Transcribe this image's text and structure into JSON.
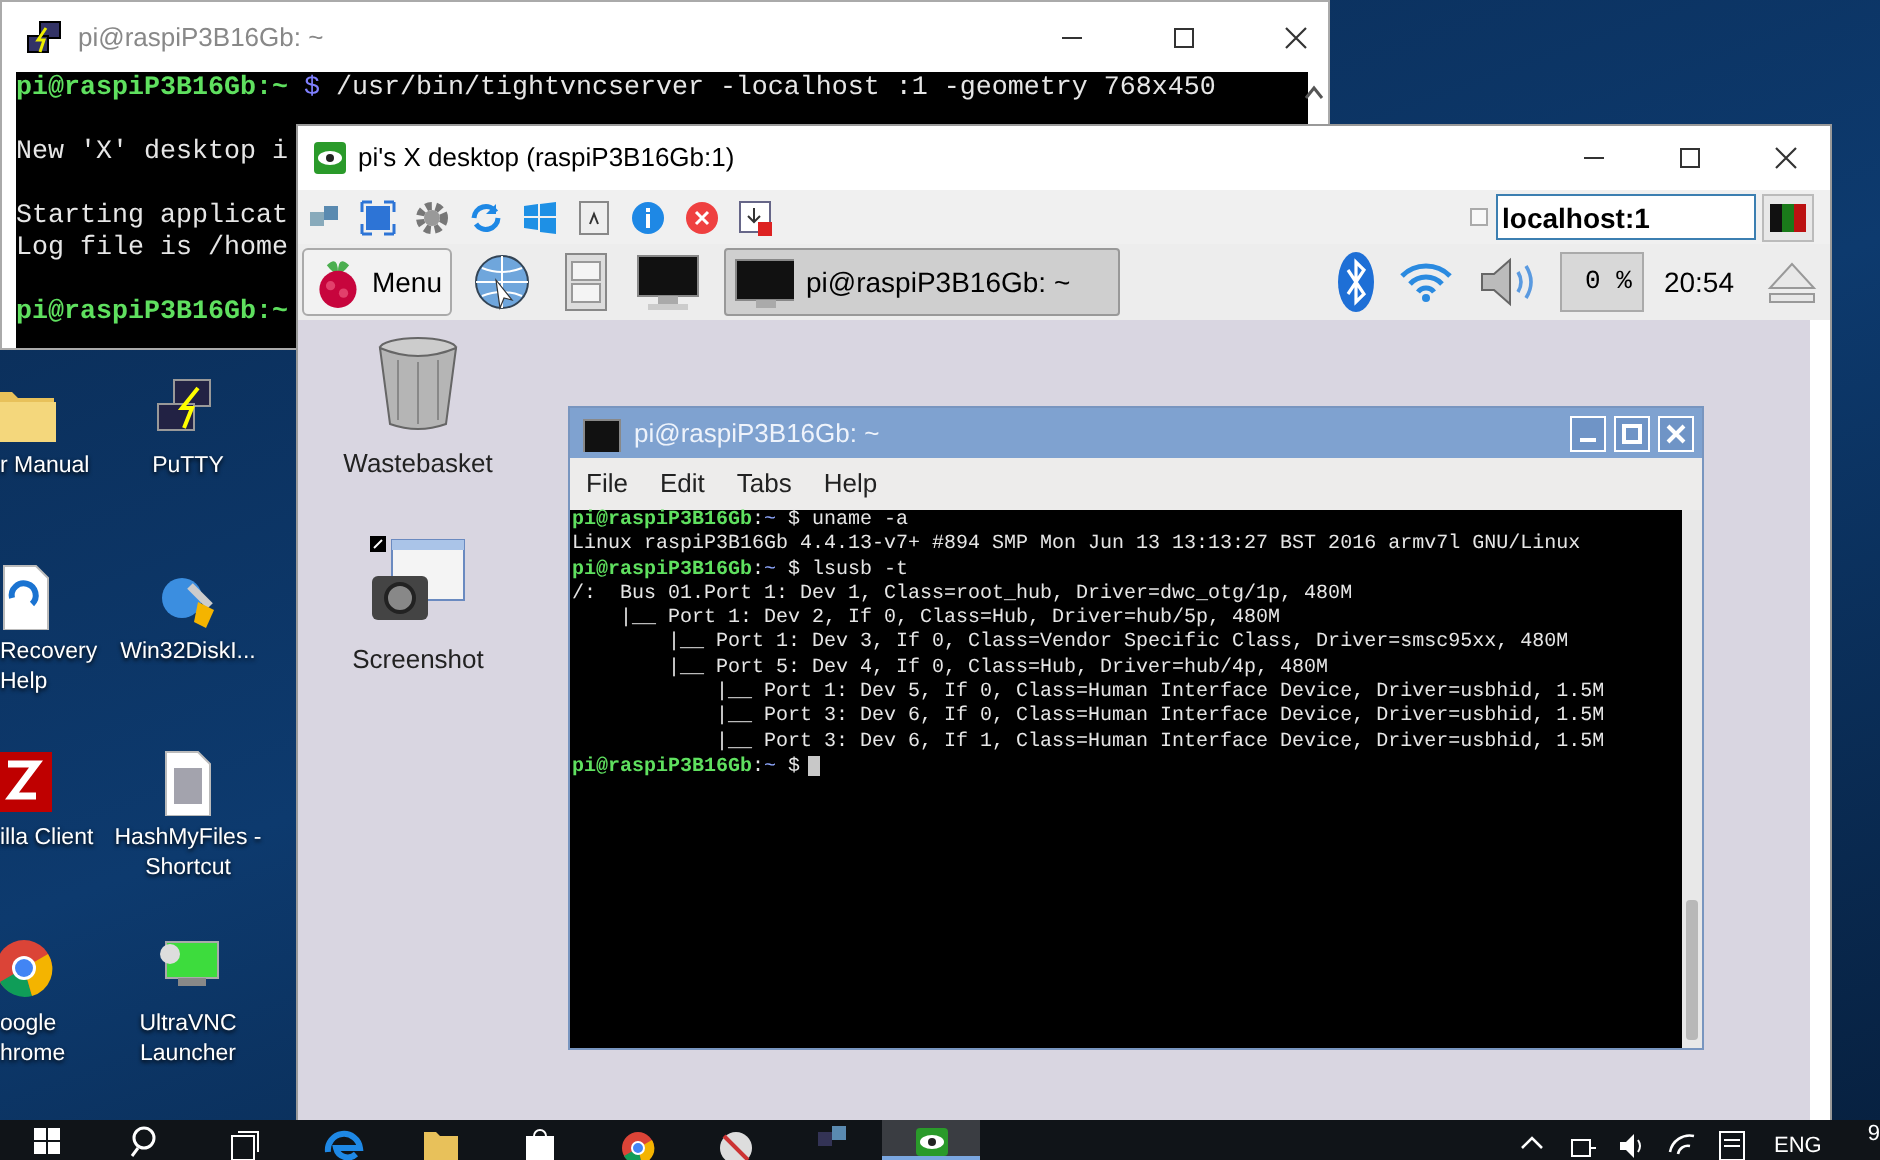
{
  "putty": {
    "title": "pi@raspiP3B16Gb: ~",
    "lines": [
      {
        "kind": "text",
        "segments": [
          {
            "text": "pi@raspiP3B16Gb:~",
            "kind": "host"
          },
          {
            "text": " $",
            "kind": "sign"
          },
          {
            "text": " /usr/bin/tightvncserver -localhost :1 -geometry 768x450",
            "kind": "plain"
          }
        ]
      },
      {
        "kind": "blank"
      },
      {
        "kind": "text",
        "segments": [
          {
            "text": "New 'X' desktop i",
            "kind": "plain"
          }
        ]
      },
      {
        "kind": "blank"
      },
      {
        "kind": "text",
        "segments": [
          {
            "text": "Starting applicat",
            "kind": "plain"
          }
        ]
      },
      {
        "kind": "text",
        "segments": [
          {
            "text": "Log file is /home",
            "kind": "plain"
          }
        ]
      },
      {
        "kind": "blank"
      },
      {
        "kind": "text",
        "segments": [
          {
            "text": "pi@raspiP3B16Gb:~",
            "kind": "host"
          }
        ]
      }
    ]
  },
  "desktop_icons": [
    {
      "label": "r Manual",
      "kind": "folder"
    },
    {
      "label": "PuTTY",
      "kind": "putty"
    },
    {
      "label": "Recovery Help",
      "kind": "pdf"
    },
    {
      "label": "Win32DiskI...",
      "kind": "disk"
    },
    {
      "label": "illa Client",
      "kind": "filezilla"
    },
    {
      "label": "HashMyFiles - Shortcut",
      "kind": "file"
    },
    {
      "label": "oogle hrome",
      "kind": "chrome"
    },
    {
      "label": "UltraVNC Launcher",
      "kind": "vnc"
    }
  ],
  "vnc": {
    "title": "pi's X desktop (raspiP3B16Gb:1)",
    "toolbar": {
      "tools": [
        {
          "kind": "network"
        },
        {
          "kind": "fullscreen"
        },
        {
          "kind": "settings"
        },
        {
          "kind": "refresh"
        },
        {
          "kind": "windows"
        },
        {
          "kind": "text"
        },
        {
          "kind": "info"
        },
        {
          "kind": "stop"
        },
        {
          "kind": "transfer"
        }
      ],
      "checkbox": {
        "checked": false
      },
      "host_field": {
        "value": "localhost:1"
      }
    },
    "panel": {
      "menu_label": "Menu",
      "launchers": [
        {
          "kind": "globe"
        },
        {
          "kind": "cabinet"
        },
        {
          "kind": "monitor"
        }
      ],
      "task": {
        "label": "pi@raspiP3B16Gb: ~",
        "selected": true
      },
      "cpu": "0 %",
      "clock": "20:54"
    },
    "desktop_icons": [
      {
        "label": "Wastebasket",
        "kind": "trash"
      },
      {
        "label": "Screenshot",
        "kind": "screenshot"
      }
    ],
    "terminal": {
      "title": "pi@raspiP3B16Gb: ~",
      "menu": [
        "File",
        "Edit",
        "Tabs",
        "Help"
      ],
      "lines": [
        {
          "segments": [
            {
              "text": "pi@raspiP3B16Gb",
              "kind": "host"
            },
            {
              "text": ":",
              "kind": "plain"
            },
            {
              "text": "~",
              "kind": "path"
            },
            {
              "text": " $ uname -a",
              "kind": "plain"
            }
          ]
        },
        {
          "segments": [
            {
              "text": "Linux raspiP3B16Gb 4.4.13-v7+ #894 SMP Mon Jun 13 13:13:27 BST 2016 armv7l GNU/Linux",
              "kind": "plain"
            }
          ]
        },
        {
          "segments": [
            {
              "text": "pi@raspiP3B16Gb",
              "kind": "host"
            },
            {
              "text": ":",
              "kind": "plain"
            },
            {
              "text": "~",
              "kind": "path"
            },
            {
              "text": " $ lsusb -t",
              "kind": "plain"
            }
          ]
        },
        {
          "segments": [
            {
              "text": "/:  Bus 01.Port 1: Dev 1, Class=root_hub, Driver=dwc_otg/1p, 480M",
              "kind": "plain"
            }
          ]
        },
        {
          "segments": [
            {
              "text": "    |__ Port 1: Dev 2, If 0, Class=Hub, Driver=hub/5p, 480M",
              "kind": "plain"
            }
          ]
        },
        {
          "segments": [
            {
              "text": "        |__ Port 1: Dev 3, If 0, Class=Vendor Specific Class, Driver=smsc95xx, 480M",
              "kind": "plain"
            }
          ]
        },
        {
          "segments": [
            {
              "text": "        |__ Port 5: Dev 4, If 0, Class=Hub, Driver=hub/4p, 480M",
              "kind": "plain"
            }
          ]
        },
        {
          "segments": [
            {
              "text": "            |__ Port 1: Dev 5, If 0, Class=Human Interface Device, Driver=usbhid, 1.5M",
              "kind": "plain"
            }
          ]
        },
        {
          "segments": [
            {
              "text": "            |__ Port 3: Dev 6, If 0, Class=Human Interface Device, Driver=usbhid, 1.5M",
              "kind": "plain"
            }
          ]
        },
        {
          "segments": [
            {
              "text": "            |__ Port 3: Dev 6, If 1, Class=Human Interface Device, Driver=usbhid, 1.5M",
              "kind": "plain"
            }
          ]
        },
        {
          "cursor": true,
          "segments": [
            {
              "text": "pi@raspiP3B16Gb",
              "kind": "host"
            },
            {
              "text": ":",
              "kind": "plain"
            },
            {
              "text": "~",
              "kind": "path"
            },
            {
              "text": " $",
              "kind": "plain"
            }
          ]
        }
      ]
    }
  },
  "taskbar": {
    "apps": [
      {
        "kind": "start",
        "selected": false
      },
      {
        "kind": "search",
        "selected": false
      },
      {
        "kind": "taskview",
        "selected": false
      },
      {
        "kind": "edge",
        "selected": false
      },
      {
        "kind": "explorer",
        "selected": false
      },
      {
        "kind": "store",
        "selected": false
      },
      {
        "kind": "chrome",
        "selected": false
      },
      {
        "kind": "tool",
        "selected": false
      },
      {
        "kind": "putty",
        "selected": false
      },
      {
        "kind": "vnc",
        "selected": true
      }
    ],
    "tray": [
      {
        "kind": "chevron"
      },
      {
        "kind": "network"
      },
      {
        "kind": "volume"
      },
      {
        "kind": "wifi"
      },
      {
        "kind": "notes"
      }
    ],
    "language": "ENG",
    "clock": "9"
  }
}
